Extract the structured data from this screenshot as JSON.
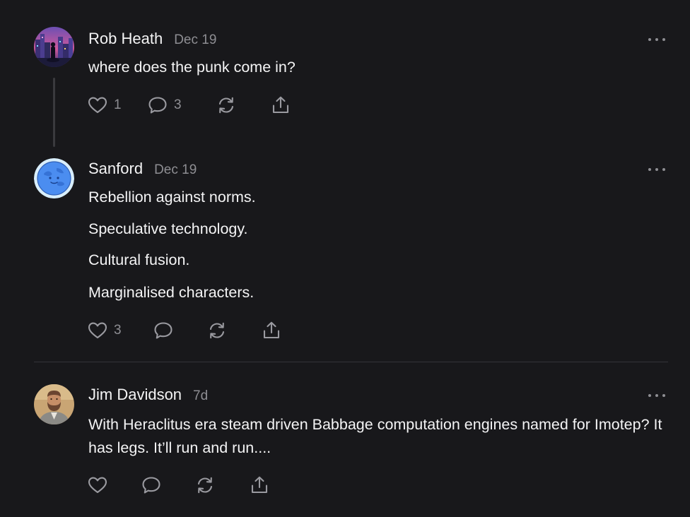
{
  "posts": [
    {
      "author": "Rob Heath",
      "date": "Dec 19",
      "avatar": "city-skyline-avatar",
      "paragraphs": [
        "where does the punk come in?"
      ],
      "actions": {
        "likes": "1",
        "comments": "3"
      }
    },
    {
      "author": "Sanford",
      "date": "Dec 19",
      "avatar": "blue-globe-avatar",
      "paragraphs": [
        "Rebellion against norms.",
        "Speculative technology.",
        "Cultural fusion.",
        "Marginalised characters."
      ],
      "actions": {
        "likes": "3",
        "comments": ""
      }
    },
    {
      "author": "Jim Davidson",
      "date": "7d",
      "avatar": "bearded-man-avatar",
      "paragraphs": [
        "With Heraclitus era steam driven Babbage computation engines named for Imotep? It has legs. It’ll run and run...."
      ],
      "actions": {
        "likes": "",
        "comments": ""
      }
    }
  ],
  "colors": {
    "background": "#18181b",
    "text": "#f4f4f5",
    "muted": "#8e8e93",
    "divider": "#34343a"
  },
  "icons": [
    "heart-icon",
    "comment-icon",
    "repost-icon",
    "share-icon",
    "more-icon"
  ]
}
